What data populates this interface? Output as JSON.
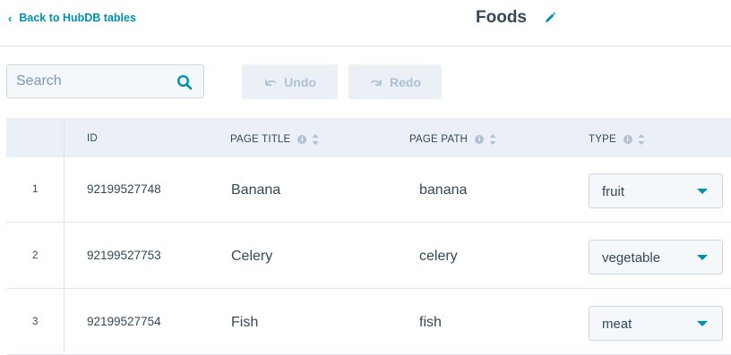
{
  "header": {
    "back_label": "Back to HubDB tables",
    "title": "Foods"
  },
  "toolbar": {
    "search_placeholder": "Search",
    "undo_label": "Undo",
    "redo_label": "Redo"
  },
  "table": {
    "columns": [
      "ID",
      "PAGE TITLE",
      "PAGE PATH",
      "TYPE"
    ],
    "rows": [
      {
        "num": "1",
        "id": "92199527748",
        "title": "Banana",
        "path": "banana",
        "type": "fruit"
      },
      {
        "num": "2",
        "id": "92199527753",
        "title": "Celery",
        "path": "celery",
        "type": "vegetable"
      },
      {
        "num": "3",
        "id": "92199527754",
        "title": "Fish",
        "path": "fish",
        "type": "meat"
      }
    ]
  },
  "colors": {
    "accent": "#0091ae",
    "text": "#33475b",
    "header_bg": "#eaf0f6",
    "border": "#dfe3eb"
  },
  "icons": [
    "chevron-left-icon",
    "pencil-icon",
    "search-icon",
    "undo-icon",
    "redo-icon",
    "info-icon",
    "sort-icon",
    "caret-down-icon"
  ]
}
